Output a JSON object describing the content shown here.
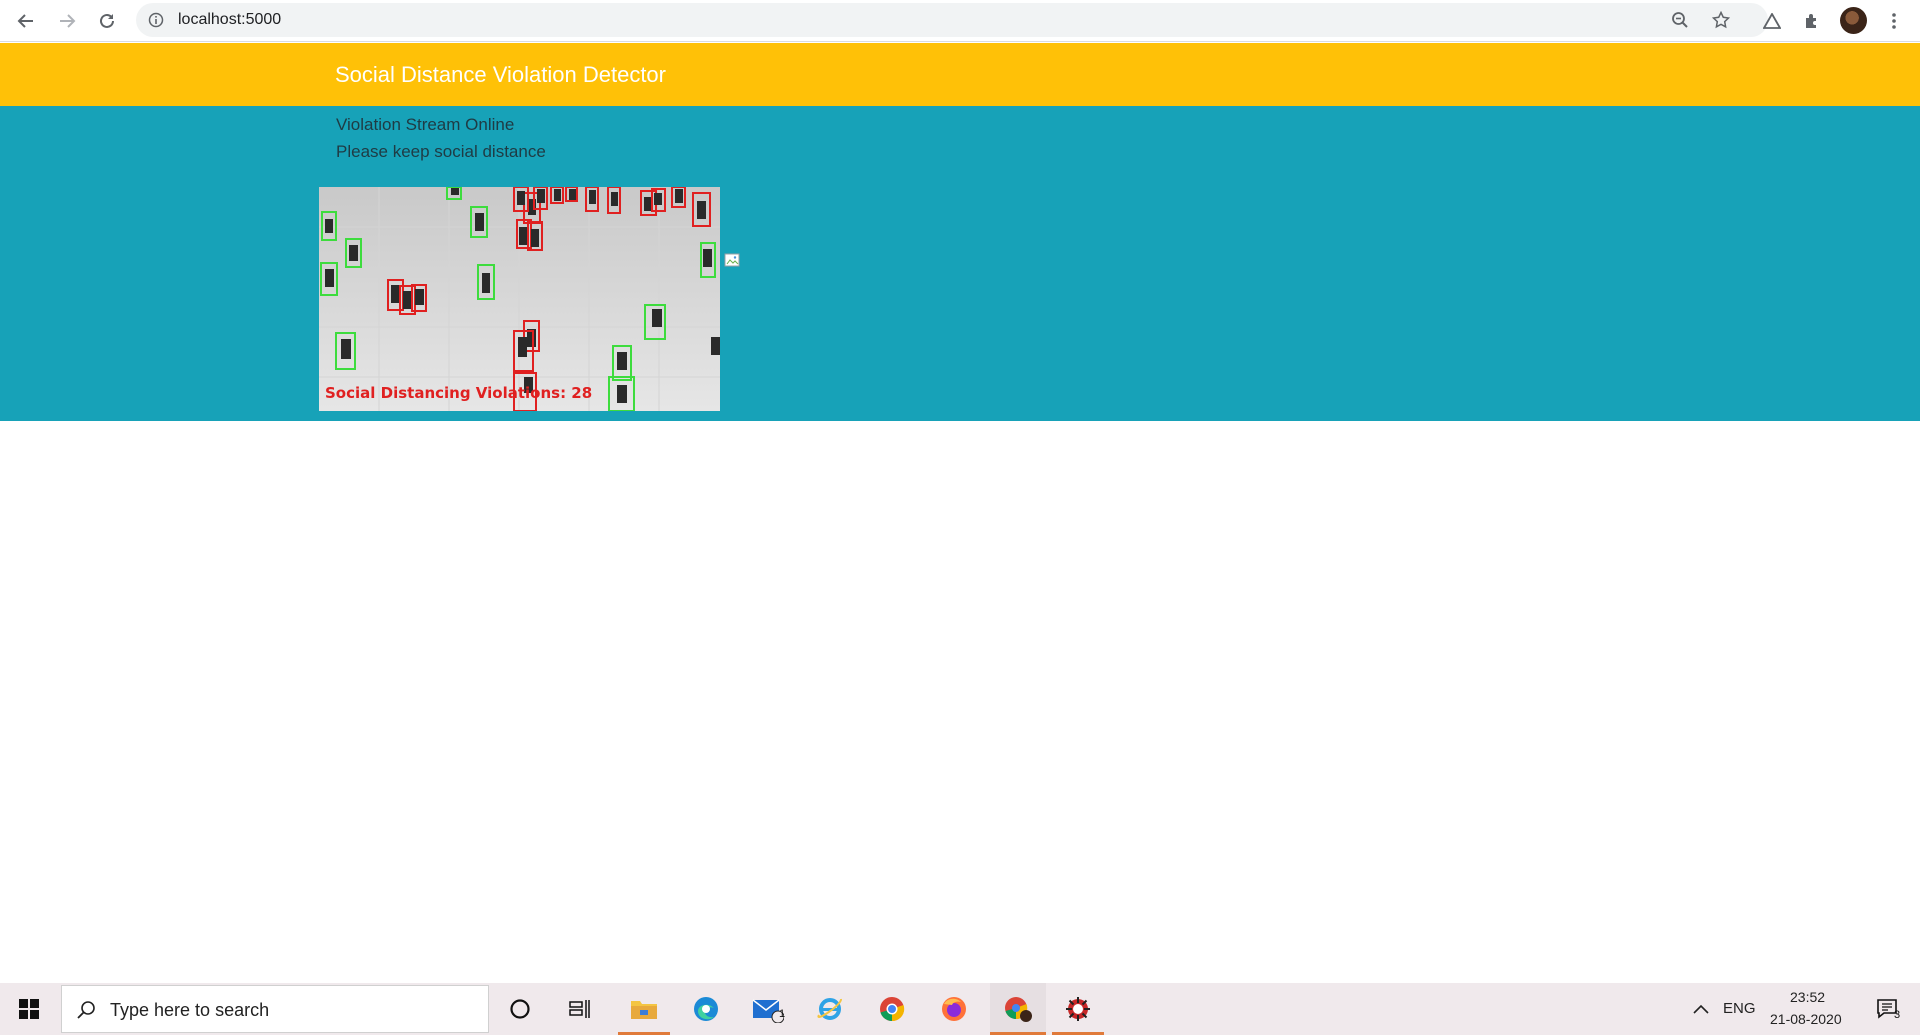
{
  "browser": {
    "url": "localhost:5000"
  },
  "page": {
    "brand": "Social Distance Violation Detector",
    "status_line1": "Violation Stream Online",
    "status_line2": "Please keep social distance",
    "feed_overlay": "Social Distancing Violations: 28"
  },
  "taskbar": {
    "search_placeholder": "Type here to search",
    "mail_badge": "1",
    "language": "ENG",
    "time": "23:52",
    "date": "21-08-2020",
    "notifications": "3"
  },
  "colors": {
    "header": "#ffc107",
    "banner": "#17a2b8",
    "violation_box": "#e02020",
    "safe_box": "#3ddc3d"
  }
}
